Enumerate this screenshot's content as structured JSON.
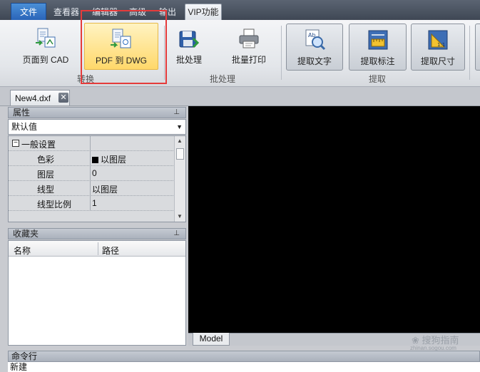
{
  "menu": {
    "tabs": [
      "文件",
      "查看器",
      "编辑器",
      "高级",
      "输出",
      "VIP功能"
    ],
    "active": "VIP功能"
  },
  "ribbon": {
    "buttons": {
      "page_to_cad": "页面到 CAD",
      "pdf_to_dwg": "PDF 到 DWG",
      "batch": "批处理",
      "batch_print": "批量打印",
      "extract_text": "提取文字",
      "extract_dim": "提取标注",
      "extract_size": "提取尺寸"
    },
    "groups": {
      "convert": "转换",
      "batch": "批处理",
      "extract": "提取"
    },
    "highlight_color": "#e53b3b"
  },
  "document": {
    "tab_label": "New4.dxf",
    "close_glyph": "✕"
  },
  "properties": {
    "title": "属性",
    "pin_glyph": "⊥",
    "selector_value": "默认值",
    "group_label": "一般设置",
    "rows": [
      {
        "name": "色彩",
        "value": "以图层"
      },
      {
        "name": "图层",
        "value": "0"
      },
      {
        "name": "线型",
        "value": "以图层"
      },
      {
        "name": "线型比例",
        "value": "1"
      }
    ]
  },
  "favorites": {
    "title": "收藏夹",
    "columns": [
      "名称",
      "路径"
    ]
  },
  "canvas": {
    "layout_tab": "Model",
    "background": "#000000"
  },
  "watermark": {
    "text": "搜狗指南",
    "url": "zhinan.sogou.com"
  },
  "command": {
    "title": "命令行",
    "text": "新建"
  }
}
